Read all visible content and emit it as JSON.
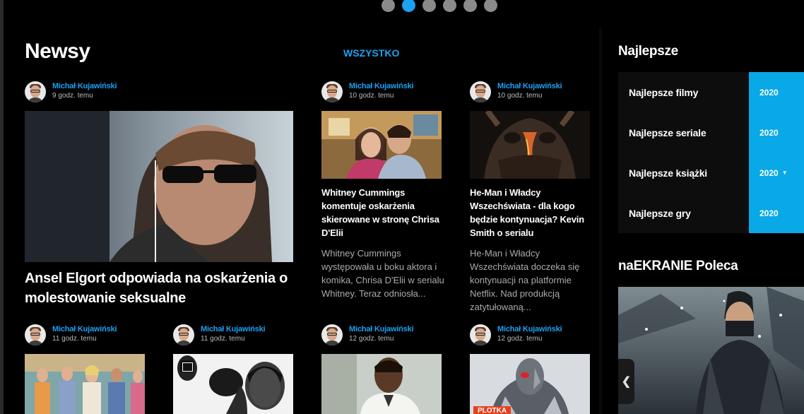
{
  "slider": {
    "dots": 6,
    "active_index": 1
  },
  "news": {
    "title": "Newsy",
    "filter_label": "WSZYSTKO",
    "featured": {
      "author": "Michał Kujawiński",
      "time": "9 godz. temu",
      "headline": "Ansel Elgort odpowiada na oskarżenia o molestowanie seksualne"
    },
    "cards": [
      {
        "author": "Michał Kujawiński",
        "time": "10 godz. temu",
        "headline": "Whitney Cummings komentuje oskarżenia skierowane w stronę Chrisa D'Elii",
        "excerpt": "Whitney Cummings występowała u boku aktora i komika, Chrisa D'Elii w serialu Whitney. Teraz odniosła..."
      },
      {
        "author": "Michał Kujawiński",
        "time": "10 godz. temu",
        "headline": "He-Man i Władcy Wszechświata - dla kogo będzie kontynuacja? Kevin Smith o serialu",
        "excerpt": "He-Man i Władcy Wszechświata doczeka się kontynuacji na platformie Netflix. Nad produkcją zatytułowaną..."
      }
    ],
    "bottom_row": [
      {
        "author": "Michał Kujawiński",
        "time": "11 godz. temu"
      },
      {
        "author": "Michał Kujawiński",
        "time": "11 godz. temu"
      },
      {
        "author": "Michał Kujawiński",
        "time": "12 godz. temu"
      },
      {
        "author": "Michał Kujawiński",
        "time": "12 godz. temu",
        "badge": "PLOTKA"
      }
    ]
  },
  "sidebar": {
    "best_title": "Najlepsze",
    "best_items": [
      {
        "label": "Najlepsze filmy",
        "year": "2020"
      },
      {
        "label": "Najlepsze seriale",
        "year": "2020"
      },
      {
        "label": "Najlepsze książki",
        "year": "2020"
      },
      {
        "label": "Najlepsze gry",
        "year": "2020"
      }
    ],
    "recommend_title": "naEKRANIE Poleca"
  },
  "colors": {
    "accent": "#1da1f2",
    "year_bg": "#08a9e6",
    "badge": "#e8401c"
  }
}
